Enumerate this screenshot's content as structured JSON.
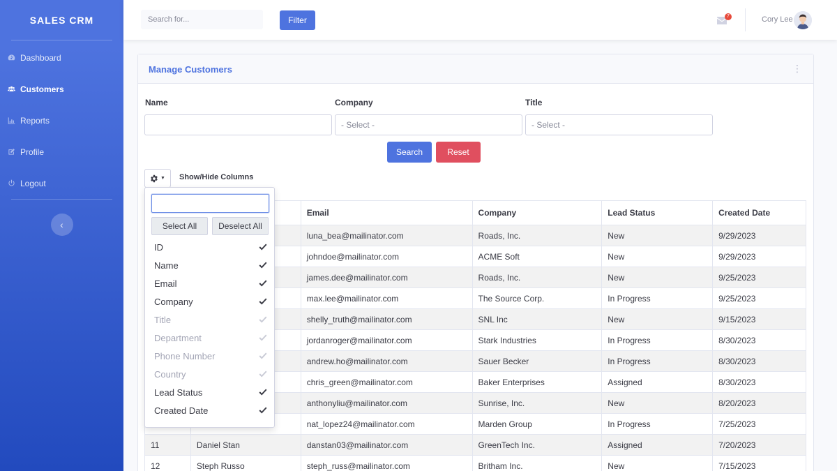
{
  "brand": "SALES CRM",
  "sidebar": {
    "items": [
      {
        "label": "Dashboard",
        "icon": "dashboard-icon",
        "active": false
      },
      {
        "label": "Customers",
        "icon": "users-icon",
        "active": true
      },
      {
        "label": "Reports",
        "icon": "chart-icon",
        "active": false
      },
      {
        "label": "Profile",
        "icon": "edit-icon",
        "active": false
      },
      {
        "label": "Logout",
        "icon": "power-icon",
        "active": false
      }
    ],
    "toggle_icon": "‹"
  },
  "topbar": {
    "search_placeholder": "Search for...",
    "filter_label": "Filter",
    "mail_count": "7",
    "user_name": "Cory Lee"
  },
  "card": {
    "title": "Manage Customers",
    "menu_icon": "⋮"
  },
  "filters": {
    "name_label": "Name",
    "company_label": "Company",
    "company_placeholder": "- Select -",
    "title_label": "Title",
    "title_placeholder": "- Select -",
    "search_label": "Search",
    "reset_label": "Reset"
  },
  "columns_toggle": {
    "label": "Show/Hide Columns",
    "select_all": "Select All",
    "deselect_all": "Deselect All",
    "items": [
      {
        "label": "ID",
        "checked": true
      },
      {
        "label": "Name",
        "checked": true
      },
      {
        "label": "Email",
        "checked": true
      },
      {
        "label": "Company",
        "checked": true
      },
      {
        "label": "Title",
        "checked": false
      },
      {
        "label": "Department",
        "checked": false
      },
      {
        "label": "Phone Number",
        "checked": false
      },
      {
        "label": "Country",
        "checked": false
      },
      {
        "label": "Lead Status",
        "checked": true
      },
      {
        "label": "Created Date",
        "checked": true
      }
    ]
  },
  "table": {
    "headers": [
      "",
      "",
      "Email",
      "Company",
      "Lead Status",
      "Created Date"
    ],
    "rows": [
      [
        "",
        "",
        "luna_bea@mailinator.com",
        "Roads, Inc.",
        "New",
        "9/29/2023"
      ],
      [
        "",
        "",
        "johndoe@mailinator.com",
        "ACME Soft",
        "New",
        "9/29/2023"
      ],
      [
        "",
        "",
        "james.dee@mailinator.com",
        "Roads, Inc.",
        "New",
        "9/25/2023"
      ],
      [
        "",
        "",
        "max.lee@mailinator.com",
        "The Source Corp.",
        "In Progress",
        "9/25/2023"
      ],
      [
        "",
        "",
        "shelly_truth@mailinator.com",
        "SNL Inc",
        "New",
        "9/15/2023"
      ],
      [
        "",
        "",
        "jordanroger@mailinator.com",
        "Stark Industries",
        "In Progress",
        "8/30/2023"
      ],
      [
        "",
        "",
        "andrew.ho@mailinator.com",
        "Sauer Becker",
        "In Progress",
        "8/30/2023"
      ],
      [
        "",
        "",
        "chris_green@mailinator.com",
        "Baker Enterprises",
        "Assigned",
        "8/30/2023"
      ],
      [
        "",
        "",
        "anthonyliu@mailinator.com",
        "Sunrise, Inc.",
        "New",
        "8/20/2023"
      ],
      [
        "",
        "",
        "nat_lopez24@mailinator.com",
        "Marden Group",
        "In Progress",
        "7/25/2023"
      ],
      [
        "11",
        "Daniel Stan",
        "danstan03@mailinator.com",
        "GreenTech Inc.",
        "Assigned",
        "7/20/2023"
      ],
      [
        "12",
        "Steph Russo",
        "steph_russ@mailinator.com",
        "Britham Inc.",
        "New",
        "7/15/2023"
      ]
    ]
  }
}
